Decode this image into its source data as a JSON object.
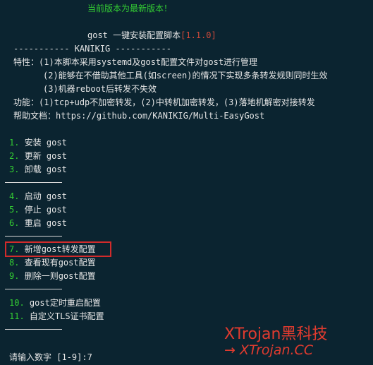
{
  "status_msg": "当前版本为最新版本！",
  "header": {
    "title": "gost 一键安装配置脚本",
    "version": "[1.1.0]",
    "author_line": "----------- KANIKIG -----------"
  },
  "features": {
    "label": "特性：",
    "items": [
      "(1)本脚本采用systemd及gost配置文件对gost进行管理",
      "(2)能够在不借助其他工具(如screen)的情况下实现多条转发规则同时生效",
      "(3)机器reboot后转发不失效"
    ]
  },
  "functions": {
    "label": "功能：",
    "text": "(1)tcp+udp不加密转发，(2)中转机加密转发，(3)落地机解密对接转发"
  },
  "help": {
    "label": "帮助文档：",
    "url": "https://github.com/KANIKIG/Multi-EasyGost"
  },
  "menu": [
    {
      "num": "1.",
      "label": "安装 gost"
    },
    {
      "num": "2.",
      "label": "更新 gost"
    },
    {
      "num": "3.",
      "label": "卸载 gost"
    },
    {
      "num": "4.",
      "label": "启动 gost"
    },
    {
      "num": "5.",
      "label": "停止 gost"
    },
    {
      "num": "6.",
      "label": "重启 gost"
    },
    {
      "num": "7.",
      "label": "新增gost转发配置"
    },
    {
      "num": "8.",
      "label": "查看现有gost配置"
    },
    {
      "num": "9.",
      "label": "删除一则gost配置"
    },
    {
      "num": "10.",
      "label": "gost定时重启配置"
    },
    {
      "num": "11.",
      "label": "自定义TLS证书配置"
    }
  ],
  "prompt": {
    "text": "请输入数字 [1-9]:",
    "value": "7"
  },
  "watermark": {
    "line1": "XTrojan黑科技",
    "line2": "→ XTrojan.CC"
  },
  "colors": {
    "background": "#0b2430",
    "accent_green": "#33cc33",
    "version_red": "#d14a3a",
    "highlight_red": "#d12b2b",
    "watermark_red": "#e03b2f"
  }
}
